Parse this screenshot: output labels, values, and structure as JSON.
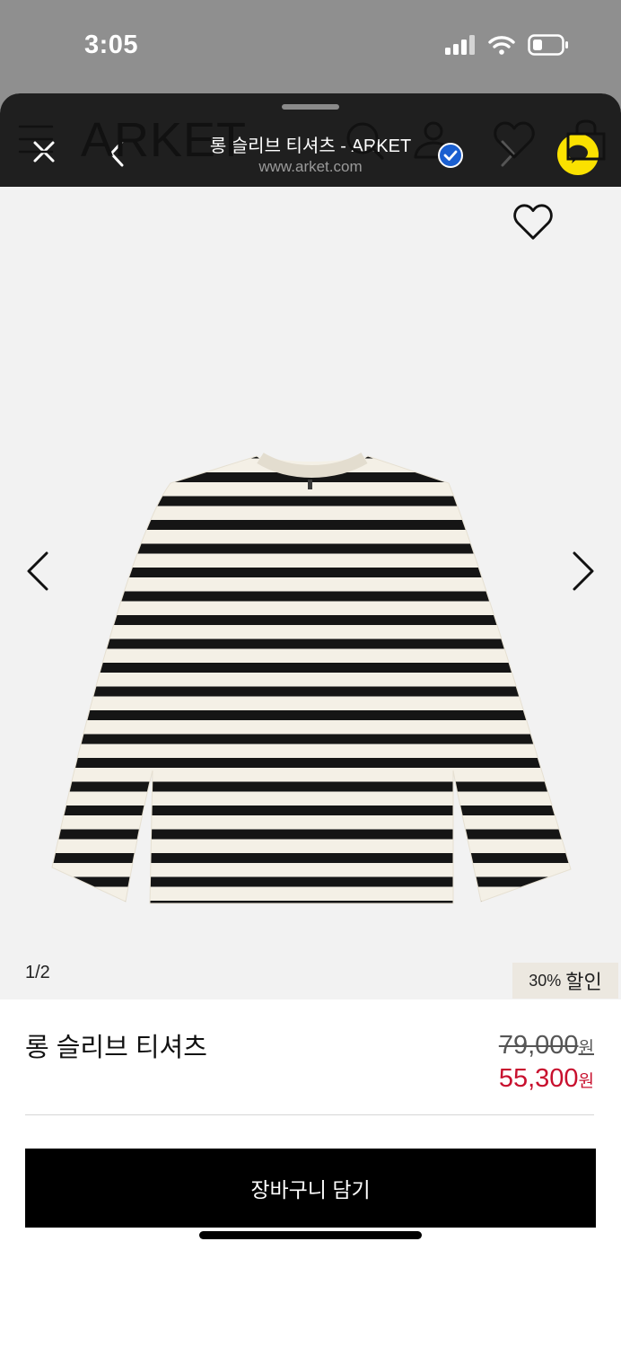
{
  "status_bar": {
    "time": "3:05"
  },
  "browser": {
    "page_title": "롱 슬리브 티셔츠 - ARKET",
    "url": "www.arket.com"
  },
  "site": {
    "logo": "ARKET",
    "icons": [
      "menu-icon",
      "search-icon",
      "account-icon",
      "wishlist-icon",
      "bag-icon"
    ]
  },
  "gallery": {
    "counter": "1/2",
    "discount_percent": "30%",
    "discount_label": "할인"
  },
  "product": {
    "name": "롱 슬리브 티셔츠",
    "original_price": "79,000",
    "sale_price": "55,300",
    "currency": "원"
  },
  "cta": {
    "add_to_cart": "장바구니 담기"
  },
  "colors": {
    "sale": "#c8102e",
    "kakao": "#fae100",
    "verified": "#1a5fd0"
  }
}
